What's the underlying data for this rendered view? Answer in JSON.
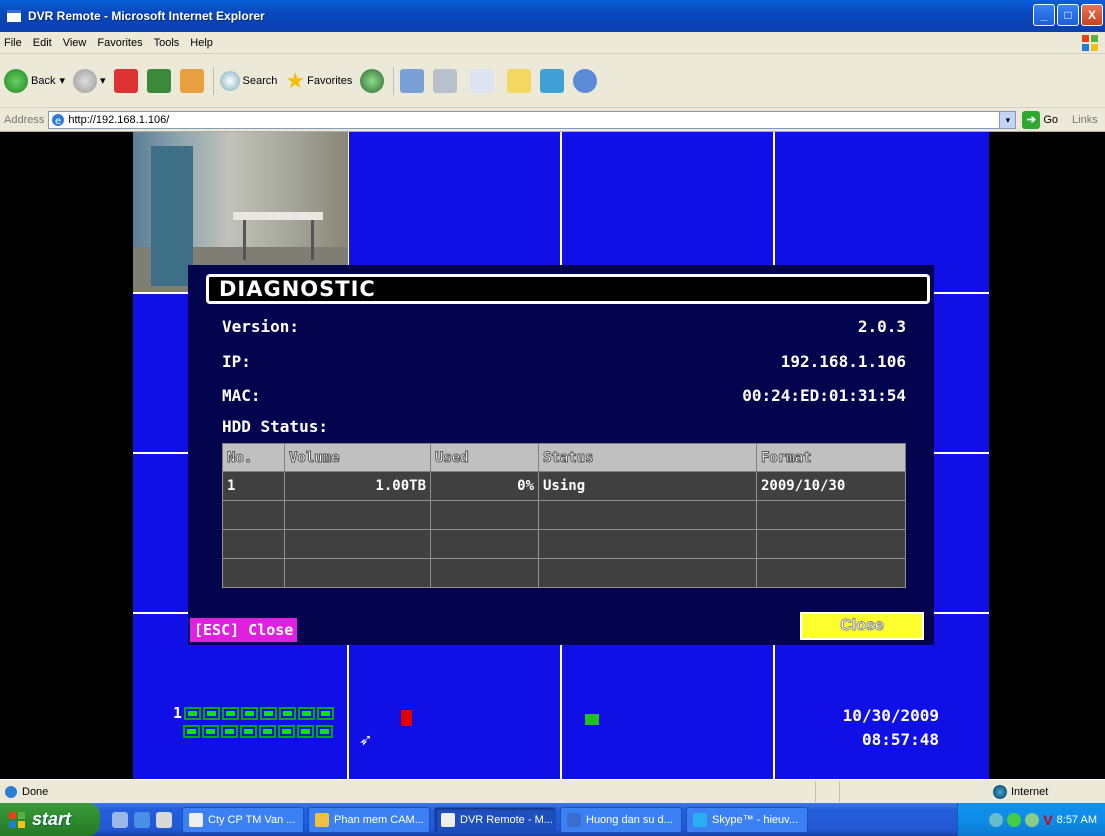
{
  "window": {
    "title": "DVR Remote - Microsoft Internet Explorer",
    "buttons": {
      "minimize": "_",
      "maximize": "□",
      "close": "X"
    }
  },
  "menu": [
    "File",
    "Edit",
    "View",
    "Favorites",
    "Tools",
    "Help"
  ],
  "toolbar": {
    "back": "Back",
    "search": "Search",
    "favorites": "Favorites"
  },
  "address": {
    "label": "Address",
    "url": "http://192.168.1.106/",
    "go": "Go",
    "links": "Links"
  },
  "dialog": {
    "title": "DIAGNOSTIC",
    "version_label": "Version:",
    "version_value": "2.0.3",
    "ip_label": "IP:",
    "ip_value": "192.168.1.106",
    "mac_label": "MAC:",
    "mac_value": "00:24:ED:01:31:54",
    "hdd_label": "HDD Status:",
    "table": {
      "headers": [
        "No.",
        "Volume",
        "Used",
        "Status",
        "Format"
      ],
      "row1": {
        "no": "1",
        "volume": "1.00TB",
        "used": "0%",
        "status": "Using",
        "format": "2009/10/30"
      }
    },
    "esc_close": "[ESC] Close",
    "close_button": "Close"
  },
  "osd": {
    "channel_prefix": "1",
    "date": "10/30/2009",
    "time": "08:57:48"
  },
  "status": {
    "text": "Done",
    "zone": "Internet"
  },
  "taskbar": {
    "start": "start",
    "tasks": [
      "Cty CP TM Van ...",
      "Phan mem CAM...",
      "DVR Remote - M...",
      "Huong dan su d...",
      "Skype™ - hieuv..."
    ],
    "clock": "8:57 AM"
  }
}
